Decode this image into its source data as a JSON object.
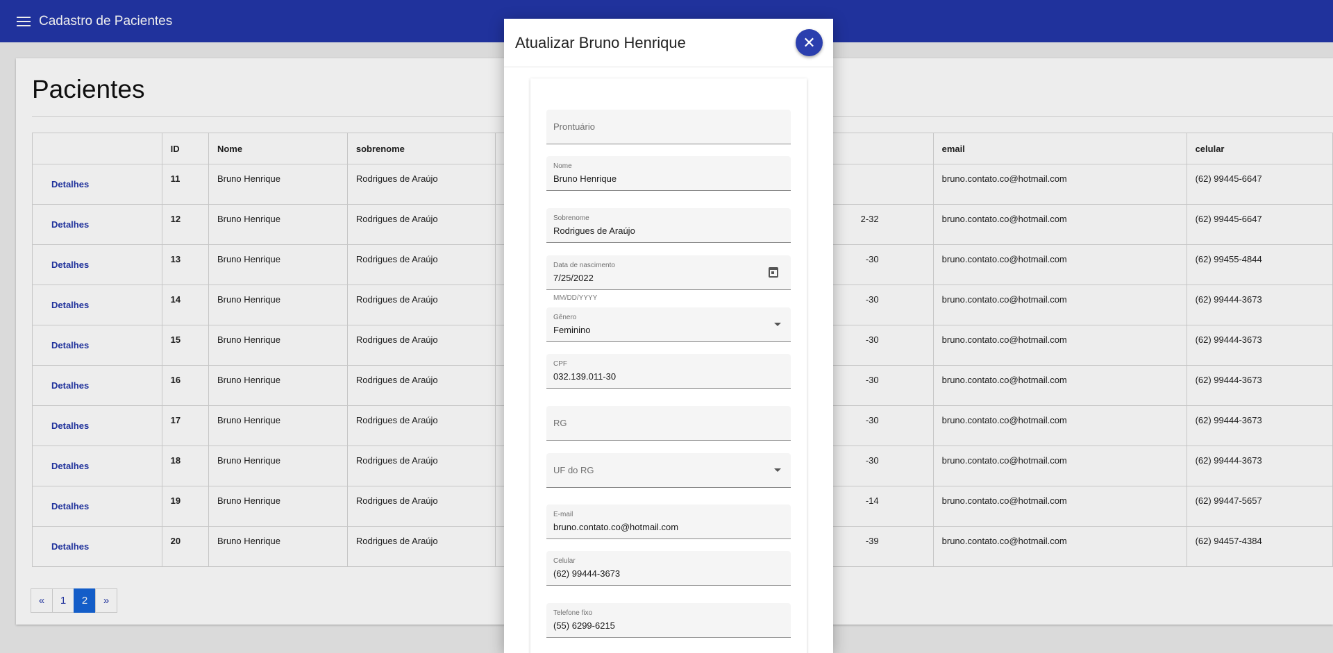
{
  "app": {
    "title": "Cadastro de Pacientes"
  },
  "page": {
    "title": "Pacientes"
  },
  "table": {
    "headers": [
      "",
      "ID",
      "Nome",
      "sobrenome",
      "",
      "email",
      "celular"
    ],
    "action_label": "Detalhes",
    "rows": [
      {
        "id": "11",
        "nome": "Bruno Henrique",
        "sobrenome": "Rodrigues de Araújo",
        "partial": "",
        "email": "bruno.contato.co@hotmail.com",
        "celular": "(62) 99445-6647"
      },
      {
        "id": "12",
        "nome": "Bruno Henrique",
        "sobrenome": "Rodrigues de Araújo",
        "partial": "2-32",
        "email": "bruno.contato.co@hotmail.com",
        "celular": "(62) 99445-6647"
      },
      {
        "id": "13",
        "nome": "Bruno Henrique",
        "sobrenome": "Rodrigues de Araújo",
        "partial": "-30",
        "email": "bruno.contato.co@hotmail.com",
        "celular": "(62) 99455-4844"
      },
      {
        "id": "14",
        "nome": "Bruno Henrique",
        "sobrenome": "Rodrigues de Araújo",
        "partial": "-30",
        "email": "bruno.contato.co@hotmail.com",
        "celular": "(62) 99444-3673"
      },
      {
        "id": "15",
        "nome": "Bruno Henrique",
        "sobrenome": "Rodrigues de Araújo",
        "partial": "-30",
        "email": "bruno.contato.co@hotmail.com",
        "celular": "(62) 99444-3673"
      },
      {
        "id": "16",
        "nome": "Bruno Henrique",
        "sobrenome": "Rodrigues de Araújo",
        "partial": "-30",
        "email": "bruno.contato.co@hotmail.com",
        "celular": "(62) 99444-3673"
      },
      {
        "id": "17",
        "nome": "Bruno Henrique",
        "sobrenome": "Rodrigues de Araújo",
        "partial": "-30",
        "email": "bruno.contato.co@hotmail.com",
        "celular": "(62) 99444-3673"
      },
      {
        "id": "18",
        "nome": "Bruno Henrique",
        "sobrenome": "Rodrigues de Araújo",
        "partial": "-30",
        "email": "bruno.contato.co@hotmail.com",
        "celular": "(62) 99444-3673"
      },
      {
        "id": "19",
        "nome": "Bruno Henrique",
        "sobrenome": "Rodrigues de Araújo",
        "partial": "-14",
        "email": "bruno.contato.co@hotmail.com",
        "celular": "(62) 99447-5657"
      },
      {
        "id": "20",
        "nome": "Bruno Henrique",
        "sobrenome": "Rodrigues de Araújo",
        "partial": "-39",
        "email": "bruno.contato.co@hotmail.com",
        "celular": "(62) 94457-4384"
      }
    ]
  },
  "pagination": {
    "prev": "«",
    "pages": [
      "1",
      "2"
    ],
    "current": "2",
    "next": "»"
  },
  "modal": {
    "title": "Atualizar Bruno Henrique",
    "close_icon": "close-icon",
    "fields": {
      "prontuario": {
        "label": "Prontuário",
        "value": ""
      },
      "nome": {
        "label": "Nome",
        "value": "Bruno Henrique"
      },
      "sobrenome": {
        "label": "Sobrenome",
        "value": "Rodrigues de Araújo"
      },
      "nascimento": {
        "label": "Data de nascimento",
        "value": "7/25/2022",
        "hint": "MM/DD/YYYY"
      },
      "genero": {
        "label": "Gênero",
        "value": "Feminino"
      },
      "cpf": {
        "label": "CPF",
        "value": "032.139.011-30"
      },
      "rg": {
        "label": "RG",
        "value": ""
      },
      "uf_rg": {
        "label": "UF do RG",
        "value": ""
      },
      "email": {
        "label": "E-mail",
        "value": "bruno.contato.co@hotmail.com"
      },
      "celular": {
        "label": "Celular",
        "value": "(62) 99444-3673"
      },
      "telefone": {
        "label": "Telefone fixo",
        "value": "(55) 6299-6215"
      }
    }
  },
  "colors": {
    "primary": "#2336a8",
    "accent_active": "#1565d8",
    "close_button": "#2b3fae"
  }
}
